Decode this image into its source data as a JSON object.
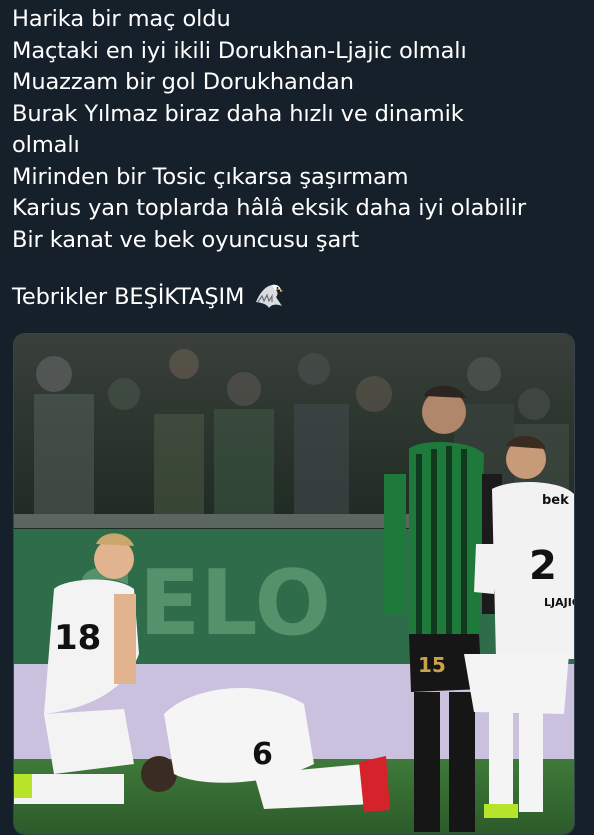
{
  "tweet": {
    "lines": [
      "Harika bir maç oldu",
      "Maçtaki en iyi ikili Dorukhan-Ljajic olmalı",
      "Muazzam bir gol Dorukhandan",
      "Burak Yılmaz biraz daha hızlı ve dinamik",
      "olmalı",
      "Mirinden bir Tosic çıkarsa şaşırmam",
      "Karius yan toplarda hâlâ eksik daha iyi olabilir",
      "Bir kanat ve bek oyuncusu şart"
    ],
    "closing": "Tebrikler BEŞİKTAŞIM",
    "closing_emoji": "eagle-emoji"
  },
  "media": {
    "type": "photo",
    "jersey_left": "18",
    "jersey_right": "2",
    "jersey_green": "15",
    "jersey_kneeling": "6",
    "name_right": "LJAJIC",
    "sponsor_right": "bek"
  },
  "colors": {
    "background": "#15202b",
    "text": "#ffffff",
    "border": "#38444d"
  }
}
